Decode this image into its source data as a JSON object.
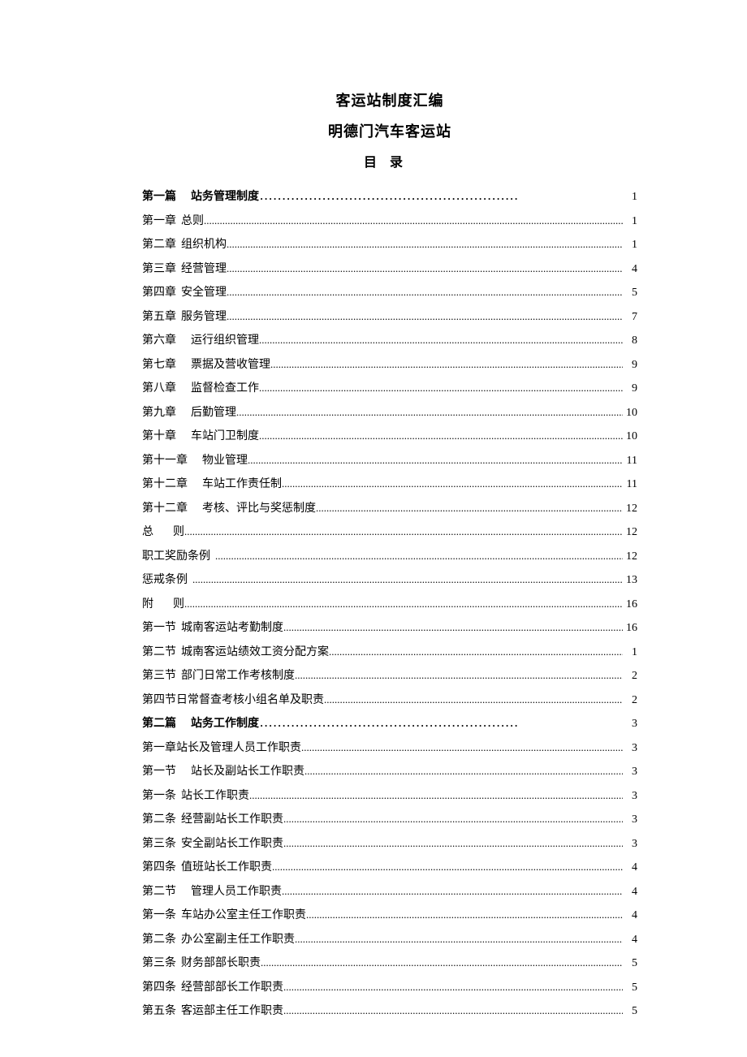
{
  "title": "客运站制度汇编",
  "subtitle": "明德门汽车客运站",
  "toc_header": "目录",
  "toc": [
    {
      "label": "第一篇",
      "text": "站务管理制度",
      "page": "1",
      "bold": true,
      "wide": true,
      "indent": 1
    },
    {
      "label": "第一章",
      "text": "总则",
      "page": "1"
    },
    {
      "label": "第二章",
      "text": "组织机构",
      "page": "1"
    },
    {
      "label": "第三章",
      "text": "经营管理",
      "page": "4"
    },
    {
      "label": "第四章",
      "text": "安全管理",
      "page": "5"
    },
    {
      "label": "第五章",
      "text": "服务管理",
      "page": "7"
    },
    {
      "label": "第六章",
      "text": "运行组织管理",
      "page": "8",
      "indent": 1
    },
    {
      "label": "第七章",
      "text": "票据及营收管理",
      "page": "9",
      "indent": 1
    },
    {
      "label": "第八章",
      "text": "监督检查工作",
      "page": "9",
      "indent": 1
    },
    {
      "label": "第九章",
      "text": "后勤管理",
      "page": "10",
      "indent": 1
    },
    {
      "label": "第十章",
      "text": "车站门卫制度",
      "page": "10",
      "indent": 1
    },
    {
      "label": "第十一章",
      "text": "物业管理",
      "page": "11",
      "indent": 1
    },
    {
      "label": "第十二章",
      "text": "车站工作责任制",
      "page": "11",
      "indent": 1
    },
    {
      "label": "第十二章",
      "text": "考核、评比与奖惩制度",
      "page": "12",
      "indent": 1
    },
    {
      "label": "总",
      "text": "则",
      "page": "12",
      "spaced": true
    },
    {
      "label": "职工奖励条例",
      "text": "",
      "page": "12"
    },
    {
      "label": "惩戒条例",
      "text": "",
      "page": "13"
    },
    {
      "label": "附",
      "text": "则",
      "page": "16",
      "spaced": true
    },
    {
      "label": "第一节",
      "text": "城南客运站考勤制度",
      "page": "16"
    },
    {
      "label": "第二节",
      "text": "城南客运站绩效工资分配方案",
      "page": "1"
    },
    {
      "label": "第三节",
      "text": "部门日常工作考核制度",
      "page": "2"
    },
    {
      "label": "第四节",
      "text": "日常督查考核小组名单及职责",
      "page": "2",
      "tight": true
    },
    {
      "label": "第二篇",
      "text": "站务工作制度",
      "page": "3",
      "bold": true,
      "wide": true,
      "indent": 1
    },
    {
      "label": "第一章",
      "text": "站长及管理人员工作职责",
      "page": "3",
      "tight": true
    },
    {
      "label": "第一节",
      "text": "站长及副站长工作职责",
      "page": "3",
      "indent": 1
    },
    {
      "label": "第一条",
      "text": "站长工作职责",
      "page": "3"
    },
    {
      "label": "第二条",
      "text": "经营副站长工作职责",
      "page": "3"
    },
    {
      "label": "第三条",
      "text": "安全副站长工作职责",
      "page": "3"
    },
    {
      "label": "第四条",
      "text": "值班站长工作职责",
      "page": "4"
    },
    {
      "label": "第二节",
      "text": "管理人员工作职责",
      "page": "4",
      "indent": 1
    },
    {
      "label": "第一条",
      "text": "车站办公室主任工作职责",
      "page": "4"
    },
    {
      "label": "第二条",
      "text": "办公室副主任工作职责",
      "page": "4"
    },
    {
      "label": "第三条",
      "text": "财务部部长职责",
      "page": "5"
    },
    {
      "label": "第四条",
      "text": "经营部部长工作职责",
      "page": "5"
    },
    {
      "label": "第五条",
      "text": "客运部主任工作职责",
      "page": "5"
    }
  ]
}
